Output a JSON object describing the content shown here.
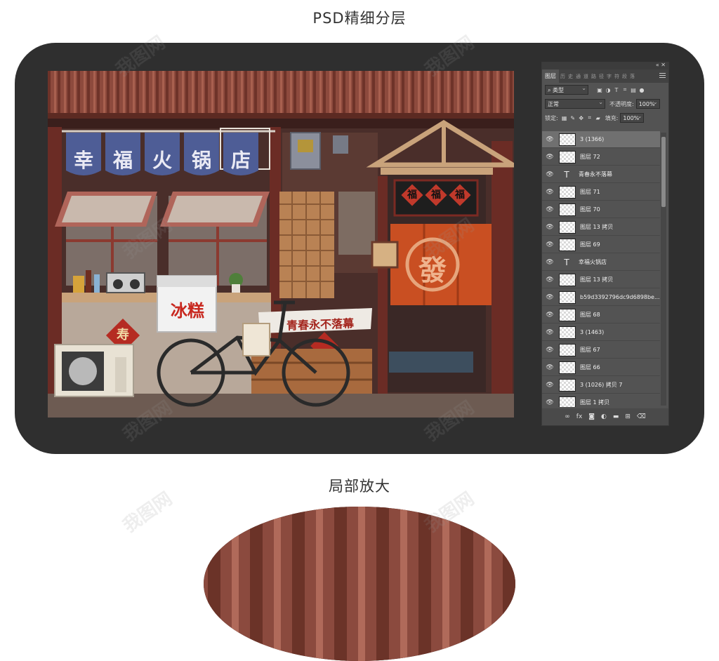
{
  "headings": {
    "top": "PSD精细分层",
    "bottom": "局部放大"
  },
  "artwork": {
    "banner_chars": [
      "幸",
      "福",
      "火",
      "锅",
      "店"
    ],
    "sign_fortune_chars": [
      "福",
      "福",
      "福"
    ],
    "curtain_char": "發",
    "cooler_text": "冰糕",
    "slogan_text": "青春永不落幕",
    "diamond_char": "寿"
  },
  "ps_panel": {
    "tab_active": "图层",
    "tabs_more": [
      "历",
      "史",
      "通",
      "道",
      "路",
      "径",
      "字",
      "符",
      "段",
      "落"
    ],
    "filter_label": "类型",
    "blend_mode": "正常",
    "opacity_label": "不透明度:",
    "opacity_value": "100%",
    "lock_label": "锁定:",
    "fill_label": "填充:",
    "fill_value": "100%",
    "layers": [
      {
        "name": "3 (1366)",
        "kind": "raster",
        "selected": true
      },
      {
        "name": "图层 72",
        "kind": "raster"
      },
      {
        "name": "青春永不落幕",
        "kind": "text"
      },
      {
        "name": "图层 71",
        "kind": "raster"
      },
      {
        "name": "图层 70",
        "kind": "raster"
      },
      {
        "name": "图层 13 拷贝",
        "kind": "raster"
      },
      {
        "name": "图层 69",
        "kind": "raster"
      },
      {
        "name": "幸福火锅店",
        "kind": "text"
      },
      {
        "name": "图层 13 拷贝",
        "kind": "raster"
      },
      {
        "name": "b59d3392796dc9d6898be...",
        "kind": "raster"
      },
      {
        "name": "图层 68",
        "kind": "raster"
      },
      {
        "name": "3 (1463)",
        "kind": "raster"
      },
      {
        "name": "图层 67",
        "kind": "raster"
      },
      {
        "name": "图层 66",
        "kind": "raster"
      },
      {
        "name": "3 (1026) 拷贝 7",
        "kind": "raster"
      },
      {
        "name": "图层 1 拷贝",
        "kind": "raster"
      }
    ],
    "bottom_icons": [
      "link-icon",
      "fx-icon",
      "mask-icon",
      "adjustment-icon",
      "folder-icon",
      "new-layer-icon",
      "trash-icon"
    ],
    "fx_label": "fx"
  },
  "watermark_text": "我图网"
}
